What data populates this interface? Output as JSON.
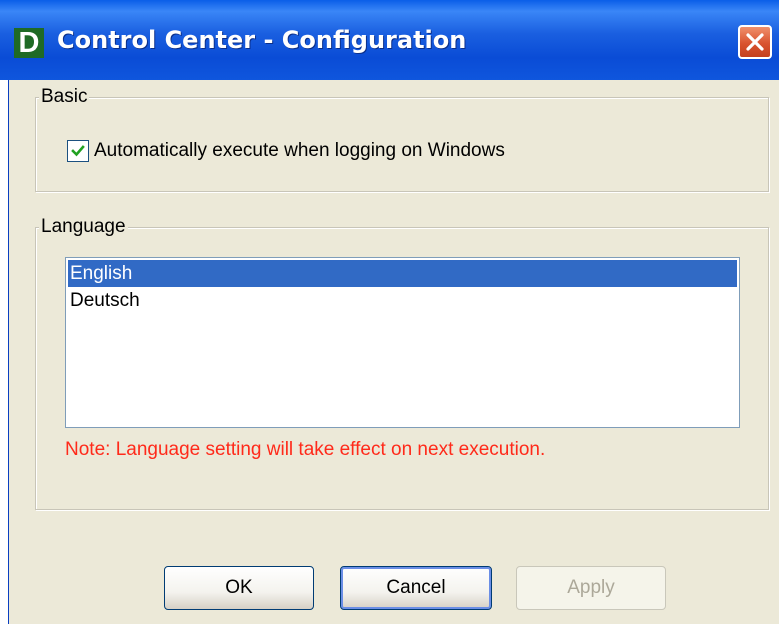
{
  "window": {
    "title": "Control Center - Configuration",
    "icon_letter": "D",
    "close_icon": "close-icon"
  },
  "basic": {
    "label": "Basic",
    "auto_execute": {
      "label": "Automatically execute when logging on Windows",
      "checked": true
    }
  },
  "language": {
    "label": "Language",
    "options": [
      "English",
      "Deutsch"
    ],
    "selected": "English",
    "note": "Note: Language setting will take effect on next execution."
  },
  "buttons": {
    "ok": "OK",
    "cancel": "Cancel",
    "apply": "Apply"
  },
  "colors": {
    "titlebar": "#0a5ee8",
    "selection": "#316ac5",
    "note": "#ff2a1a",
    "dialog_bg": "#ece9d8"
  }
}
